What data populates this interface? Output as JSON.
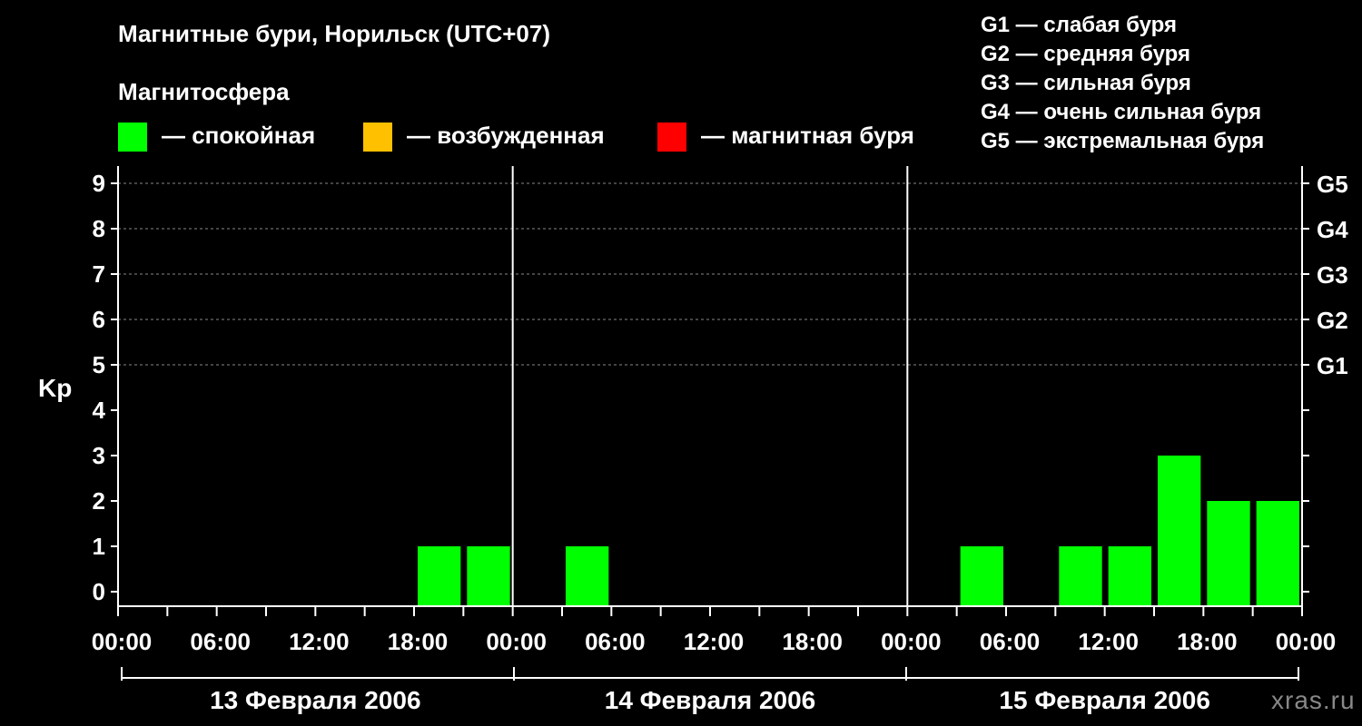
{
  "title": "Магнитные бури, Норильск (UTC+07)",
  "subtitle": "Магнитосфера",
  "legend": [
    {
      "label": "— спокойная",
      "color": "#00ff00"
    },
    {
      "label": "— возбужденная",
      "color": "#ffc000"
    },
    {
      "label": "— магнитная буря",
      "color": "#ff0000"
    }
  ],
  "g_legend": [
    "G1 — слабая буря",
    "G2 — средняя буря",
    "G3 — сильная буря",
    "G4 — очень сильная буря",
    "G5 — экстремальная буря"
  ],
  "watermark": "xras.ru",
  "chart_data": {
    "type": "bar",
    "ylabel": "Kp",
    "ylim": [
      0,
      9
    ],
    "y_ticks": [
      "0",
      "1",
      "2",
      "3",
      "4",
      "5",
      "6",
      "7",
      "8",
      "9"
    ],
    "right_labels": [
      {
        "kp": 5,
        "label": "G1"
      },
      {
        "kp": 6,
        "label": "G2"
      },
      {
        "kp": 7,
        "label": "G3"
      },
      {
        "kp": 8,
        "label": "G4"
      },
      {
        "kp": 9,
        "label": "G5"
      }
    ],
    "x_tick_labels": [
      "00:00",
      "06:00",
      "12:00",
      "18:00",
      "00:00",
      "06:00",
      "12:00",
      "18:00",
      "00:00",
      "06:00",
      "12:00",
      "18:00",
      "00:00"
    ],
    "days": [
      "13 Февраля 2006",
      "14 Февраля 2006",
      "15 Февраля 2006"
    ],
    "categories": [
      "13 Февраля 2006 00:00",
      "13 Февраля 2006 03:00",
      "13 Февраля 2006 06:00",
      "13 Февраля 2006 09:00",
      "13 Февраля 2006 12:00",
      "13 Февраля 2006 15:00",
      "13 Февраля 2006 18:00",
      "13 Февраля 2006 21:00",
      "14 Февраля 2006 00:00",
      "14 Февраля 2006 03:00",
      "14 Февраля 2006 06:00",
      "14 Февраля 2006 09:00",
      "14 Февраля 2006 12:00",
      "14 Февраля 2006 15:00",
      "14 Февраля 2006 18:00",
      "14 Февраля 2006 21:00",
      "15 Февраля 2006 00:00",
      "15 Февраля 2006 03:00",
      "15 Февраля 2006 06:00",
      "15 Февраля 2006 09:00",
      "15 Февраля 2006 12:00",
      "15 Февраля 2006 15:00",
      "15 Февраля 2006 18:00",
      "15 Февраля 2006 21:00"
    ],
    "values": [
      0,
      0,
      0,
      0,
      0,
      0,
      1,
      1,
      0,
      1,
      0,
      0,
      0,
      0,
      0,
      0,
      0,
      1,
      0,
      1,
      1,
      3,
      2,
      2
    ],
    "bar_color": "#00ff00",
    "grid_kp": [
      5,
      6,
      7,
      8,
      9
    ]
  }
}
